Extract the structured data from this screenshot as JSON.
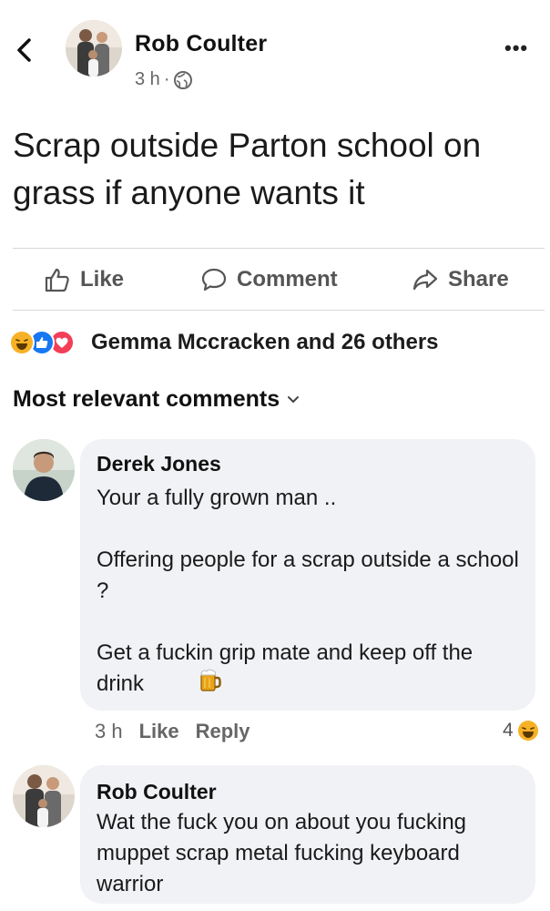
{
  "post": {
    "author": "Rob Coulter",
    "time": "3 h",
    "meta_separator": "·",
    "text": "Scrap outside Parton school on grass if anyone wants it",
    "more": "•••"
  },
  "actions": {
    "like": "Like",
    "comment": "Comment",
    "share": "Share"
  },
  "reactions": {
    "summary": "Gemma Mccracken and 26 others",
    "types": [
      "haha",
      "like",
      "love"
    ]
  },
  "sort": {
    "label": "Most relevant comments"
  },
  "comments": [
    {
      "author": "Derek Jones",
      "text": "Your a fully grown man ..\n\nOffering people for a scrap outside a school ?\n\nGet a fuckin grip mate and keep off the drink",
      "emoji": "beer-mug",
      "time": "3 h",
      "like": "Like",
      "reply": "Reply",
      "reaction_count": "4",
      "reaction_type": "haha"
    },
    {
      "author": "Rob Coulter",
      "text": "Wat the fuck you on about you fucking muppet scrap metal fucking keyboard warrior"
    }
  ],
  "colors": {
    "bubble": "#f0f2f5",
    "like_blue": "#1877f2",
    "love_red": "#f33e58",
    "haha_yellow": "#f7b125"
  }
}
